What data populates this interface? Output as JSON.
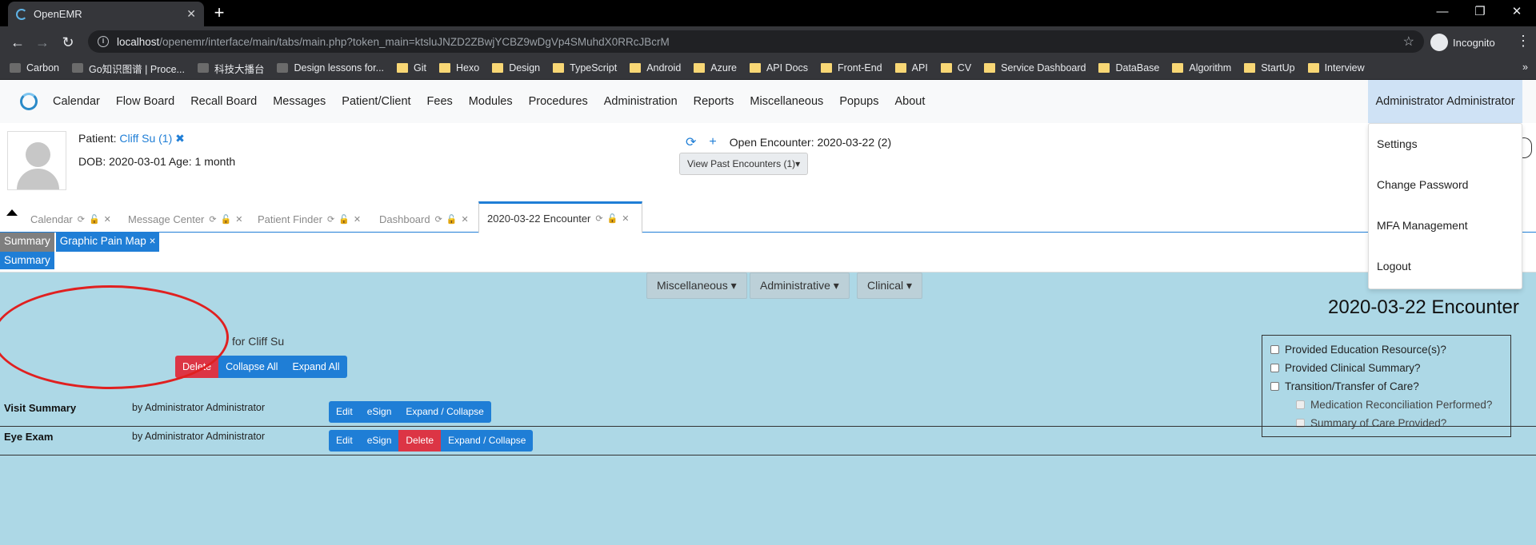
{
  "browser": {
    "tab_title": "OpenEMR",
    "url_host": "localhost",
    "url_path": "/openemr/interface/main/tabs/main.php?token_main=ktsluJNZD2ZBwjYCBZ9wDgVp4SMuhdX0RRcJBcrM",
    "incognito_label": "Incognito",
    "win_min": "—",
    "win_restore": "❐",
    "win_close": "✕",
    "bookmarks": [
      {
        "label": "Carbon",
        "icon": "site-icon"
      },
      {
        "label": "Go知识图谱 | Proce...",
        "icon": "site-icon"
      },
      {
        "label": "科技大播台",
        "icon": "site-icon"
      },
      {
        "label": "Design lessons for...",
        "icon": "site-icon"
      },
      {
        "label": "Git",
        "icon": "folder-icon"
      },
      {
        "label": "Hexo",
        "icon": "folder-icon"
      },
      {
        "label": "Design",
        "icon": "folder-icon"
      },
      {
        "label": "TypeScript",
        "icon": "folder-icon"
      },
      {
        "label": "Android",
        "icon": "folder-icon"
      },
      {
        "label": "Azure",
        "icon": "folder-icon"
      },
      {
        "label": "API Docs",
        "icon": "folder-icon"
      },
      {
        "label": "Front-End",
        "icon": "folder-icon"
      },
      {
        "label": "API",
        "icon": "folder-icon"
      },
      {
        "label": "CV",
        "icon": "folder-icon"
      },
      {
        "label": "Service Dashboard",
        "icon": "folder-icon"
      },
      {
        "label": "DataBase",
        "icon": "folder-icon"
      },
      {
        "label": "Algorithm",
        "icon": "folder-icon"
      },
      {
        "label": "StartUp",
        "icon": "folder-icon"
      },
      {
        "label": "Interview",
        "icon": "folder-icon"
      }
    ],
    "bookmarks_more": "»"
  },
  "nav": {
    "menu": [
      "Calendar",
      "Flow Board",
      "Recall Board",
      "Messages",
      "Patient/Client",
      "Fees",
      "Modules",
      "Procedures",
      "Administration",
      "Reports",
      "Miscellaneous",
      "Popups",
      "About"
    ],
    "user": "Administrator Administrator",
    "user_dropdown": [
      "Settings",
      "Change Password",
      "MFA Management",
      "Logout"
    ]
  },
  "patient": {
    "label": "Patient:",
    "name": "Cliff Su (1)",
    "close": "✖",
    "dob_line": "DOB: 2020-03-01 Age: 1 month",
    "open_encounter": "Open Encounter: 2020-03-22 (2)",
    "past_encounters_button": "View Past Encounters  (1)▾"
  },
  "tabs": [
    {
      "label": "Calendar",
      "active": false
    },
    {
      "label": "Message Center",
      "active": false
    },
    {
      "label": "Patient Finder",
      "active": false
    },
    {
      "label": "Dashboard",
      "active": false
    },
    {
      "label": "2020-03-22 Encounter",
      "active": true
    }
  ],
  "subtabs": {
    "summary": "Summary",
    "pain_map": "Graphic Pain Map ×",
    "summary_row": "Summary"
  },
  "encounter": {
    "categories": [
      "Miscellaneous ▾",
      "Administrative ▾",
      "Clinical ▾"
    ],
    "title": "2020-03-22 Encounter",
    "for_patient": "for Cliff Su",
    "actions": [
      "Delete",
      "Collapse All",
      "Expand All"
    ],
    "checklist": [
      {
        "label": "Provided Education Resource(s)?",
        "sub": false
      },
      {
        "label": "Provided Clinical Summary?",
        "sub": false
      },
      {
        "label": "Transition/Transfer of Care?",
        "sub": false
      },
      {
        "label": "Medication Reconciliation Performed?",
        "sub": true
      },
      {
        "label": "Summary of Care Provided?",
        "sub": true
      }
    ],
    "forms": [
      {
        "name": "Visit Summary",
        "author": "by Administrator Administrator",
        "buttons": [
          "Edit",
          "eSign",
          "Expand / Collapse"
        ]
      },
      {
        "name": "Eye Exam",
        "author": "by Administrator Administrator",
        "buttons": [
          "Edit",
          "eSign",
          "Delete",
          "Expand / Collapse"
        ]
      }
    ]
  },
  "colors": {
    "primary": "#1f7ed6",
    "danger": "#dc3545",
    "encounter_bg": "#add8e6",
    "annotation": "#e02020"
  }
}
